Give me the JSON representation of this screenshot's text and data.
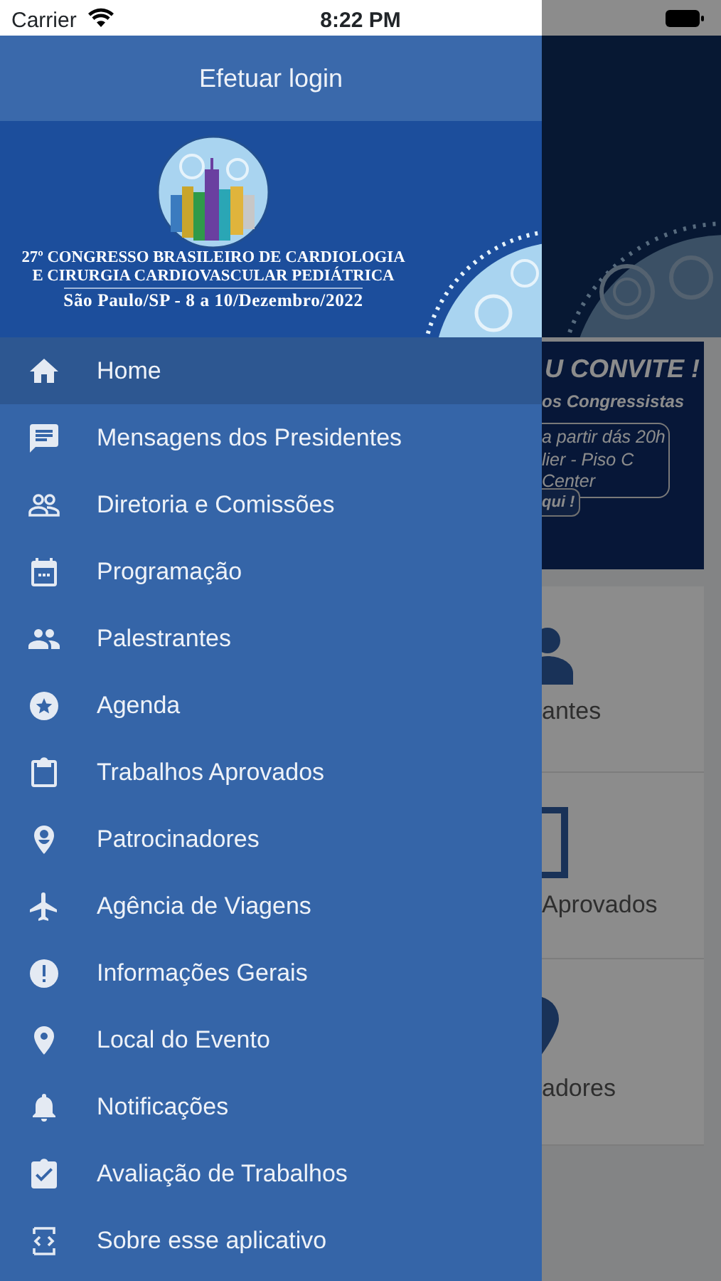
{
  "status_bar": {
    "carrier": "Carrier",
    "time": "8:22 PM"
  },
  "drawer": {
    "login": "Efetuar login",
    "banner_lines": [
      "27º CONGRESSO BRASILEIRO DE CARDIOLOGIA",
      "E CIRURGIA CARDIOVASCULAR PEDIÁTRICA",
      "São Paulo/SP - 8 a 10/Dezembro/2022"
    ],
    "items": [
      {
        "label": "Home",
        "selected": true
      },
      {
        "label": "Mensagens dos Presidentes",
        "selected": false
      },
      {
        "label": "Diretoria e Comissões",
        "selected": false
      },
      {
        "label": "Programação",
        "selected": false
      },
      {
        "label": "Palestrantes",
        "selected": false
      },
      {
        "label": "Agenda",
        "selected": false
      },
      {
        "label": "Trabalhos Aprovados",
        "selected": false
      },
      {
        "label": "Patrocinadores",
        "selected": false
      },
      {
        "label": "Agência de Viagens",
        "selected": false
      },
      {
        "label": "Informações Gerais",
        "selected": false
      },
      {
        "label": "Local do Evento",
        "selected": false
      },
      {
        "label": "Notificações",
        "selected": false
      },
      {
        "label": "Avaliação de Trabalhos",
        "selected": false
      },
      {
        "label": "Sobre esse aplicativo",
        "selected": false
      }
    ]
  },
  "background": {
    "invite": {
      "title": "U CONVITE !",
      "subtitle": "os Congressistas",
      "details": [
        "a partir dás 20h",
        "lier - Piso C",
        "Center"
      ],
      "button": "qui !"
    },
    "tiles": [
      {
        "label": "antes"
      },
      {
        "label": "Aprovados"
      },
      {
        "label": "adores"
      }
    ]
  }
}
